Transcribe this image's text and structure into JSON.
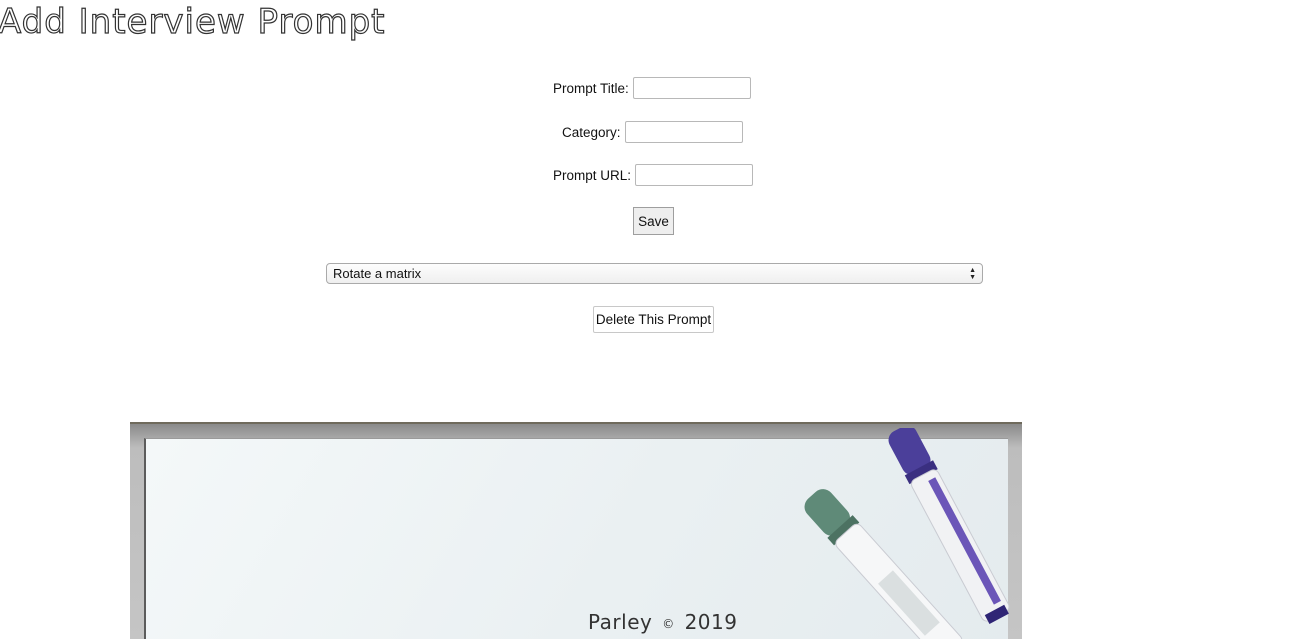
{
  "page": {
    "title": "Add Interview Prompt"
  },
  "form": {
    "prompt_title_label": "Prompt Title:",
    "prompt_title_value": "",
    "category_label": "Category:",
    "category_value": "",
    "prompt_url_label": "Prompt URL:",
    "prompt_url_value": "",
    "save_label": "Save"
  },
  "prompt_select": {
    "selected": "Rotate a matrix"
  },
  "delete_label": "Delete This Prompt",
  "footer": {
    "brand": "Parley",
    "copyright_symbol": "©",
    "year": "2019"
  },
  "icons": {
    "select_arrows": "updown-icon"
  }
}
